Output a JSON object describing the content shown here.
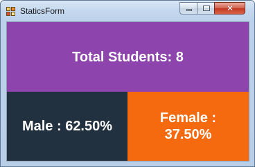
{
  "window": {
    "title": "StaticsForm",
    "controls": {
      "minimize": "minimize",
      "maximize": "maximize",
      "close": "✕"
    }
  },
  "stats": {
    "total_label": "Total Students: 8",
    "male_label": "Male : 62.50%",
    "female_label": "Female : 37.50%"
  },
  "colors": {
    "total_panel": "#8e44ad",
    "male_panel": "#22313f",
    "female_panel": "#f56a0f"
  }
}
